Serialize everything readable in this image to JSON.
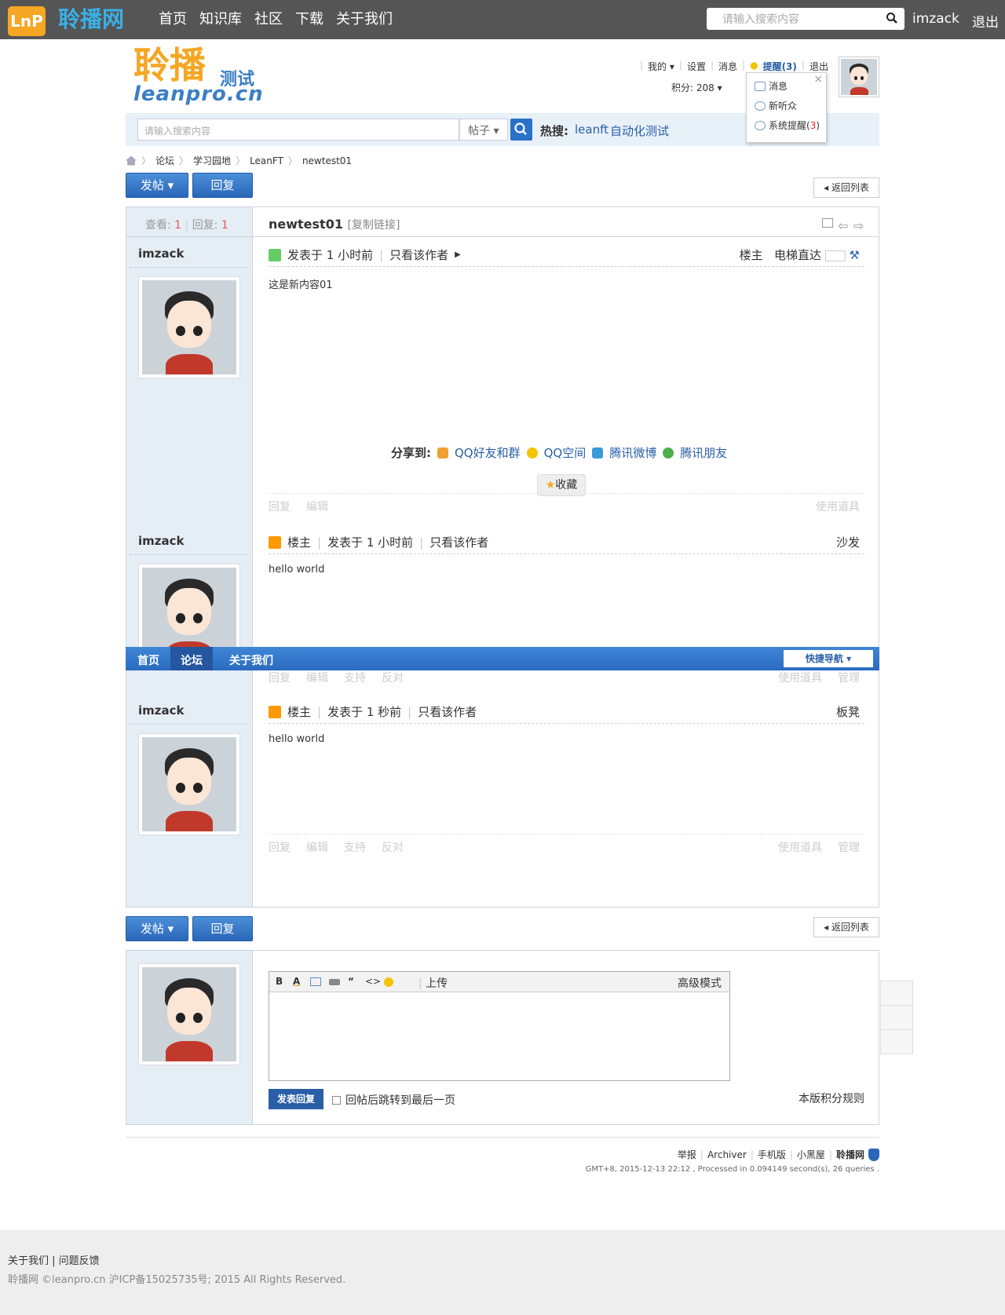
{
  "topbar": {
    "logo": "LnP",
    "site_name": "聆播网",
    "nav": [
      "首页",
      "知识库",
      "社区",
      "下载",
      "关于我们"
    ],
    "search_placeholder": "请输入搜索内容",
    "username": "imzack",
    "logout": "退出"
  },
  "header": {
    "logo_cn": "聆播",
    "logo_test": "测试",
    "logo_en": "leanpro.cn",
    "user_menu": {
      "mine": "我的",
      "settings": "设置",
      "messages": "消息",
      "remind": "提醒(3)",
      "logout": "退出"
    },
    "points": "积分: 208"
  },
  "notify_popup": {
    "items": [
      "消息",
      "新听众"
    ],
    "system_prefix": "系统提醒(",
    "system_count": "3",
    "system_suffix": ")"
  },
  "searchbar": {
    "placeholder": "请输入搜索内容",
    "type": "帖子",
    "hot_label": "热搜:",
    "hot_terms": [
      "leanft",
      "自动化测试"
    ]
  },
  "breadcrumb": [
    "论坛",
    "学习园地",
    "LeanFT",
    "newtest01"
  ],
  "buttons": {
    "new_post": "发帖",
    "reply": "回复",
    "back_list": "返回列表"
  },
  "thread": {
    "views_label": "查看:",
    "views": "1",
    "replies_label": "回复:",
    "replies": "1",
    "title": "newtest01",
    "copy_link": "[复制链接]"
  },
  "posts": [
    {
      "author": "imzack",
      "time": "发表于 1 小时前",
      "only_author": "只看该作者",
      "floor_label": "楼主",
      "elevator": "电梯直达",
      "content": "这是新内容01",
      "actions": [
        "回复",
        "编辑"
      ],
      "right_actions": [
        "使用道具"
      ]
    },
    {
      "author": "imzack",
      "owner": "楼主",
      "time": "发表于 1 小时前",
      "only_author": "只看该作者",
      "floor_label": "沙发",
      "content": "hello world",
      "actions": [
        "回复",
        "编辑",
        "支持",
        "反对"
      ],
      "right_actions": [
        "使用道具",
        "管理"
      ]
    },
    {
      "author": "imzack",
      "owner": "楼主",
      "time": "发表于 1 秒前",
      "only_author": "只看该作者",
      "floor_label": "板凳",
      "content": "hello world",
      "actions": [
        "回复",
        "编辑",
        "支持",
        "反对"
      ],
      "right_actions": [
        "使用道具",
        "管理"
      ]
    }
  ],
  "share": {
    "label": "分享到:",
    "targets": [
      "QQ好友和群",
      "QQ空间",
      "腾讯微博",
      "腾讯朋友"
    ],
    "favorite": "收藏"
  },
  "floatnav": {
    "items": [
      "首页",
      "论坛",
      "关于我们"
    ],
    "quick": "快捷导航"
  },
  "reply_box": {
    "toolbar": [
      "B",
      "A",
      "“",
      "<>"
    ],
    "upload": "上传",
    "advanced": "高级模式",
    "submit": "发表回复",
    "jump": "回帖后跳转到最后一页",
    "rules": "本版积分规则"
  },
  "footer": {
    "links": [
      "举报",
      "Archiver",
      "手机版",
      "小黑屋",
      "聆播网"
    ],
    "gmt": "GMT+8, 2015-12-13 22:12 , Processed in 0.094149 second(s), 26 queries ."
  },
  "page_footer": {
    "line1": "关于我们 | 问题反馈",
    "line2": "聆播网 ©leanpro.cn 沪ICP备15025735号; 2015 All Rights Reserved."
  }
}
